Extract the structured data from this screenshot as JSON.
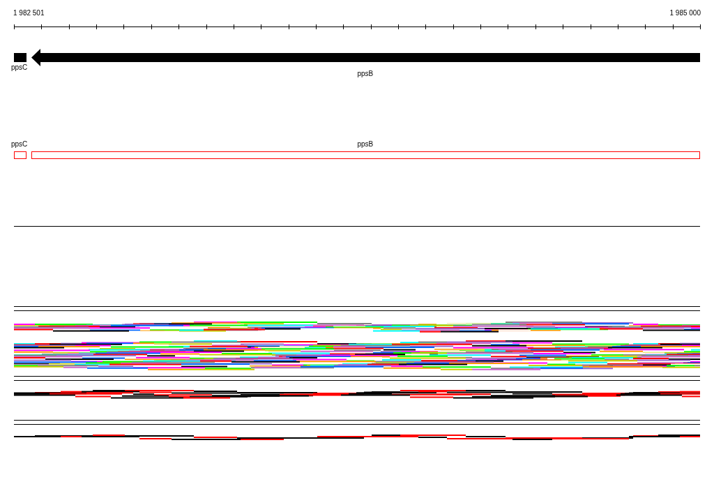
{
  "ruler": {
    "start_label": "1 982 501",
    "end_label": "1 985 000"
  },
  "gene_tracks": [
    {
      "kind": "filled",
      "genes": [
        {
          "name": "ppsC",
          "kind": "block"
        },
        {
          "name": "ppsB",
          "kind": "arrow"
        }
      ]
    },
    {
      "kind": "outline",
      "genes": [
        {
          "name": "ppsC",
          "kind": "block"
        },
        {
          "name": "ppsB",
          "kind": "block"
        }
      ]
    }
  ]
}
